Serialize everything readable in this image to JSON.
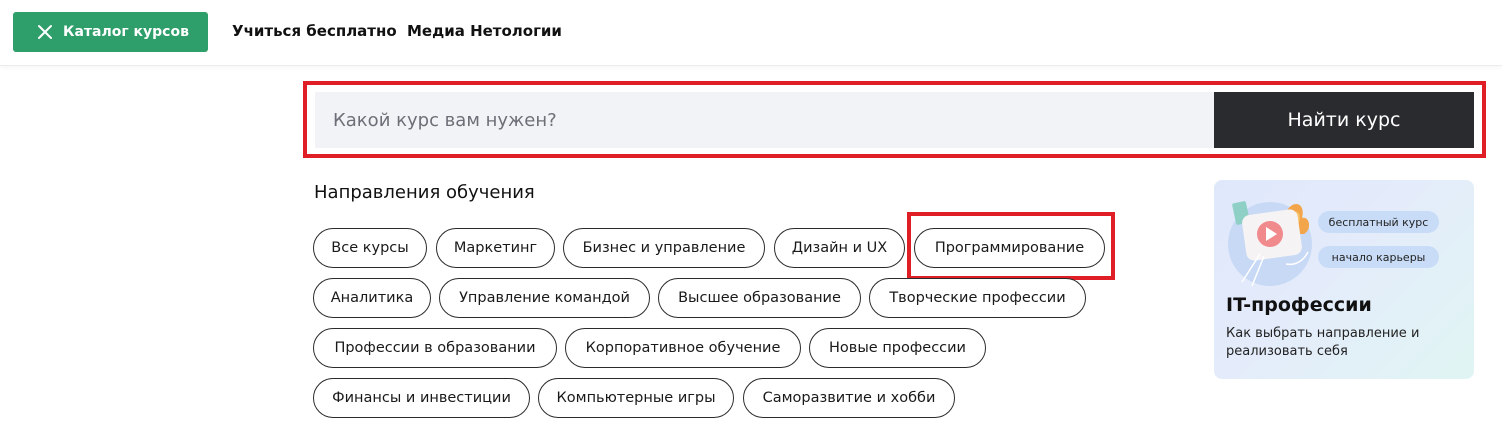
{
  "header": {
    "catalog_button": "Каталог курсов",
    "nav": {
      "free": "Учиться бесплатно",
      "media": "Медиа Нетологии"
    }
  },
  "search": {
    "placeholder": "Какой курс вам нужен?",
    "value": "",
    "button": "Найти курс"
  },
  "directions": {
    "title": "Направления обучения",
    "chips": [
      "Все курсы",
      "Маркетинг",
      "Бизнес и управление",
      "Дизайн и UX",
      "Программирование",
      "Аналитика",
      "Управление командой",
      "Высшее образование",
      "Творческие профессии",
      "Профессии в образовании",
      "Корпоративное обучение",
      "Новые профессии",
      "Финансы и инвестиции",
      "Компьютерные игры",
      "Саморазвитие и хобби"
    ]
  },
  "promo": {
    "tags": [
      "бесплатный курс",
      "начало карьеры"
    ],
    "title": "IT-профессии",
    "description": "Как выбрать направление и реализовать себя"
  },
  "colors": {
    "brand_green": "#2e9e6a",
    "search_button": "#2a2b2e",
    "highlight_red": "#e01e26",
    "search_bg": "#f2f3f6"
  },
  "icons": {
    "catalog": "close-icon"
  }
}
